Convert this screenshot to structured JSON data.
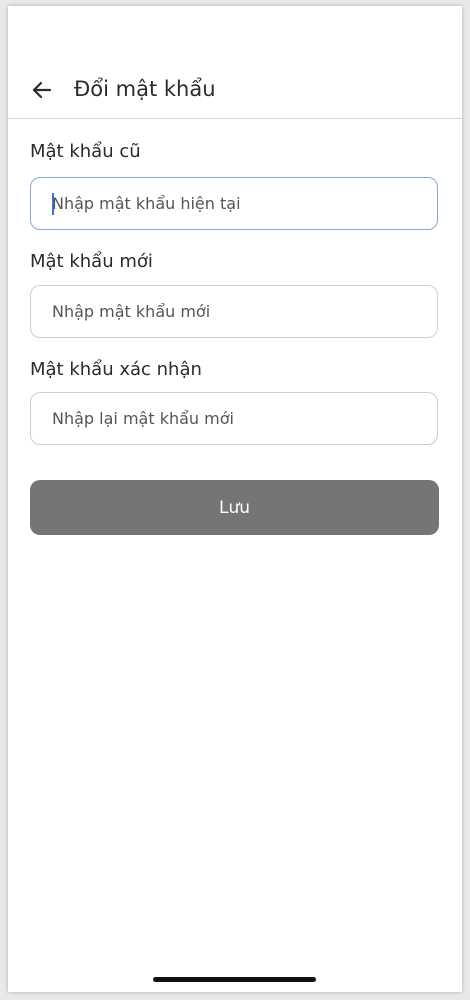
{
  "header": {
    "title": "Đổi mật khẩu",
    "back_icon": "arrow-left-icon"
  },
  "form": {
    "old_password": {
      "label": "Mật khẩu cũ",
      "placeholder": "Nhập mật khẩu hiện tại",
      "value": ""
    },
    "new_password": {
      "label": "Mật khẩu mới",
      "placeholder": "Nhập mật khẩu mới",
      "value": ""
    },
    "confirm_password": {
      "label": "Mật khẩu xác nhận",
      "placeholder": "Nhập lại mật khẩu mới",
      "value": ""
    },
    "save_label": "Lưu"
  },
  "colors": {
    "button_bg": "#757575",
    "focus_border": "#8aa6cf",
    "caret": "#3a78d8"
  }
}
